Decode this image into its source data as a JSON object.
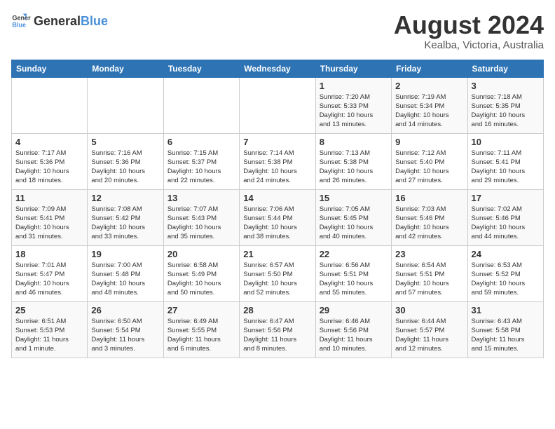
{
  "header": {
    "logo_general": "General",
    "logo_blue": "Blue",
    "month_title": "August 2024",
    "location": "Kealba, Victoria, Australia"
  },
  "weekdays": [
    "Sunday",
    "Monday",
    "Tuesday",
    "Wednesday",
    "Thursday",
    "Friday",
    "Saturday"
  ],
  "weeks": [
    [
      {
        "day": "",
        "info": ""
      },
      {
        "day": "",
        "info": ""
      },
      {
        "day": "",
        "info": ""
      },
      {
        "day": "",
        "info": ""
      },
      {
        "day": "1",
        "info": "Sunrise: 7:20 AM\nSunset: 5:33 PM\nDaylight: 10 hours\nand 13 minutes."
      },
      {
        "day": "2",
        "info": "Sunrise: 7:19 AM\nSunset: 5:34 PM\nDaylight: 10 hours\nand 14 minutes."
      },
      {
        "day": "3",
        "info": "Sunrise: 7:18 AM\nSunset: 5:35 PM\nDaylight: 10 hours\nand 16 minutes."
      }
    ],
    [
      {
        "day": "4",
        "info": "Sunrise: 7:17 AM\nSunset: 5:36 PM\nDaylight: 10 hours\nand 18 minutes."
      },
      {
        "day": "5",
        "info": "Sunrise: 7:16 AM\nSunset: 5:36 PM\nDaylight: 10 hours\nand 20 minutes."
      },
      {
        "day": "6",
        "info": "Sunrise: 7:15 AM\nSunset: 5:37 PM\nDaylight: 10 hours\nand 22 minutes."
      },
      {
        "day": "7",
        "info": "Sunrise: 7:14 AM\nSunset: 5:38 PM\nDaylight: 10 hours\nand 24 minutes."
      },
      {
        "day": "8",
        "info": "Sunrise: 7:13 AM\nSunset: 5:38 PM\nDaylight: 10 hours\nand 26 minutes."
      },
      {
        "day": "9",
        "info": "Sunrise: 7:12 AM\nSunset: 5:40 PM\nDaylight: 10 hours\nand 27 minutes."
      },
      {
        "day": "10",
        "info": "Sunrise: 7:11 AM\nSunset: 5:41 PM\nDaylight: 10 hours\nand 29 minutes."
      }
    ],
    [
      {
        "day": "11",
        "info": "Sunrise: 7:09 AM\nSunset: 5:41 PM\nDaylight: 10 hours\nand 31 minutes."
      },
      {
        "day": "12",
        "info": "Sunrise: 7:08 AM\nSunset: 5:42 PM\nDaylight: 10 hours\nand 33 minutes."
      },
      {
        "day": "13",
        "info": "Sunrise: 7:07 AM\nSunset: 5:43 PM\nDaylight: 10 hours\nand 35 minutes."
      },
      {
        "day": "14",
        "info": "Sunrise: 7:06 AM\nSunset: 5:44 PM\nDaylight: 10 hours\nand 38 minutes."
      },
      {
        "day": "15",
        "info": "Sunrise: 7:05 AM\nSunset: 5:45 PM\nDaylight: 10 hours\nand 40 minutes."
      },
      {
        "day": "16",
        "info": "Sunrise: 7:03 AM\nSunset: 5:46 PM\nDaylight: 10 hours\nand 42 minutes."
      },
      {
        "day": "17",
        "info": "Sunrise: 7:02 AM\nSunset: 5:46 PM\nDaylight: 10 hours\nand 44 minutes."
      }
    ],
    [
      {
        "day": "18",
        "info": "Sunrise: 7:01 AM\nSunset: 5:47 PM\nDaylight: 10 hours\nand 46 minutes."
      },
      {
        "day": "19",
        "info": "Sunrise: 7:00 AM\nSunset: 5:48 PM\nDaylight: 10 hours\nand 48 minutes."
      },
      {
        "day": "20",
        "info": "Sunrise: 6:58 AM\nSunset: 5:49 PM\nDaylight: 10 hours\nand 50 minutes."
      },
      {
        "day": "21",
        "info": "Sunrise: 6:57 AM\nSunset: 5:50 PM\nDaylight: 10 hours\nand 52 minutes."
      },
      {
        "day": "22",
        "info": "Sunrise: 6:56 AM\nSunset: 5:51 PM\nDaylight: 10 hours\nand 55 minutes."
      },
      {
        "day": "23",
        "info": "Sunrise: 6:54 AM\nSunset: 5:51 PM\nDaylight: 10 hours\nand 57 minutes."
      },
      {
        "day": "24",
        "info": "Sunrise: 6:53 AM\nSunset: 5:52 PM\nDaylight: 10 hours\nand 59 minutes."
      }
    ],
    [
      {
        "day": "25",
        "info": "Sunrise: 6:51 AM\nSunset: 5:53 PM\nDaylight: 11 hours\nand 1 minute."
      },
      {
        "day": "26",
        "info": "Sunrise: 6:50 AM\nSunset: 5:54 PM\nDaylight: 11 hours\nand 3 minutes."
      },
      {
        "day": "27",
        "info": "Sunrise: 6:49 AM\nSunset: 5:55 PM\nDaylight: 11 hours\nand 6 minutes."
      },
      {
        "day": "28",
        "info": "Sunrise: 6:47 AM\nSunset: 5:56 PM\nDaylight: 11 hours\nand 8 minutes."
      },
      {
        "day": "29",
        "info": "Sunrise: 6:46 AM\nSunset: 5:56 PM\nDaylight: 11 hours\nand 10 minutes."
      },
      {
        "day": "30",
        "info": "Sunrise: 6:44 AM\nSunset: 5:57 PM\nDaylight: 11 hours\nand 12 minutes."
      },
      {
        "day": "31",
        "info": "Sunrise: 6:43 AM\nSunset: 5:58 PM\nDaylight: 11 hours\nand 15 minutes."
      }
    ]
  ]
}
